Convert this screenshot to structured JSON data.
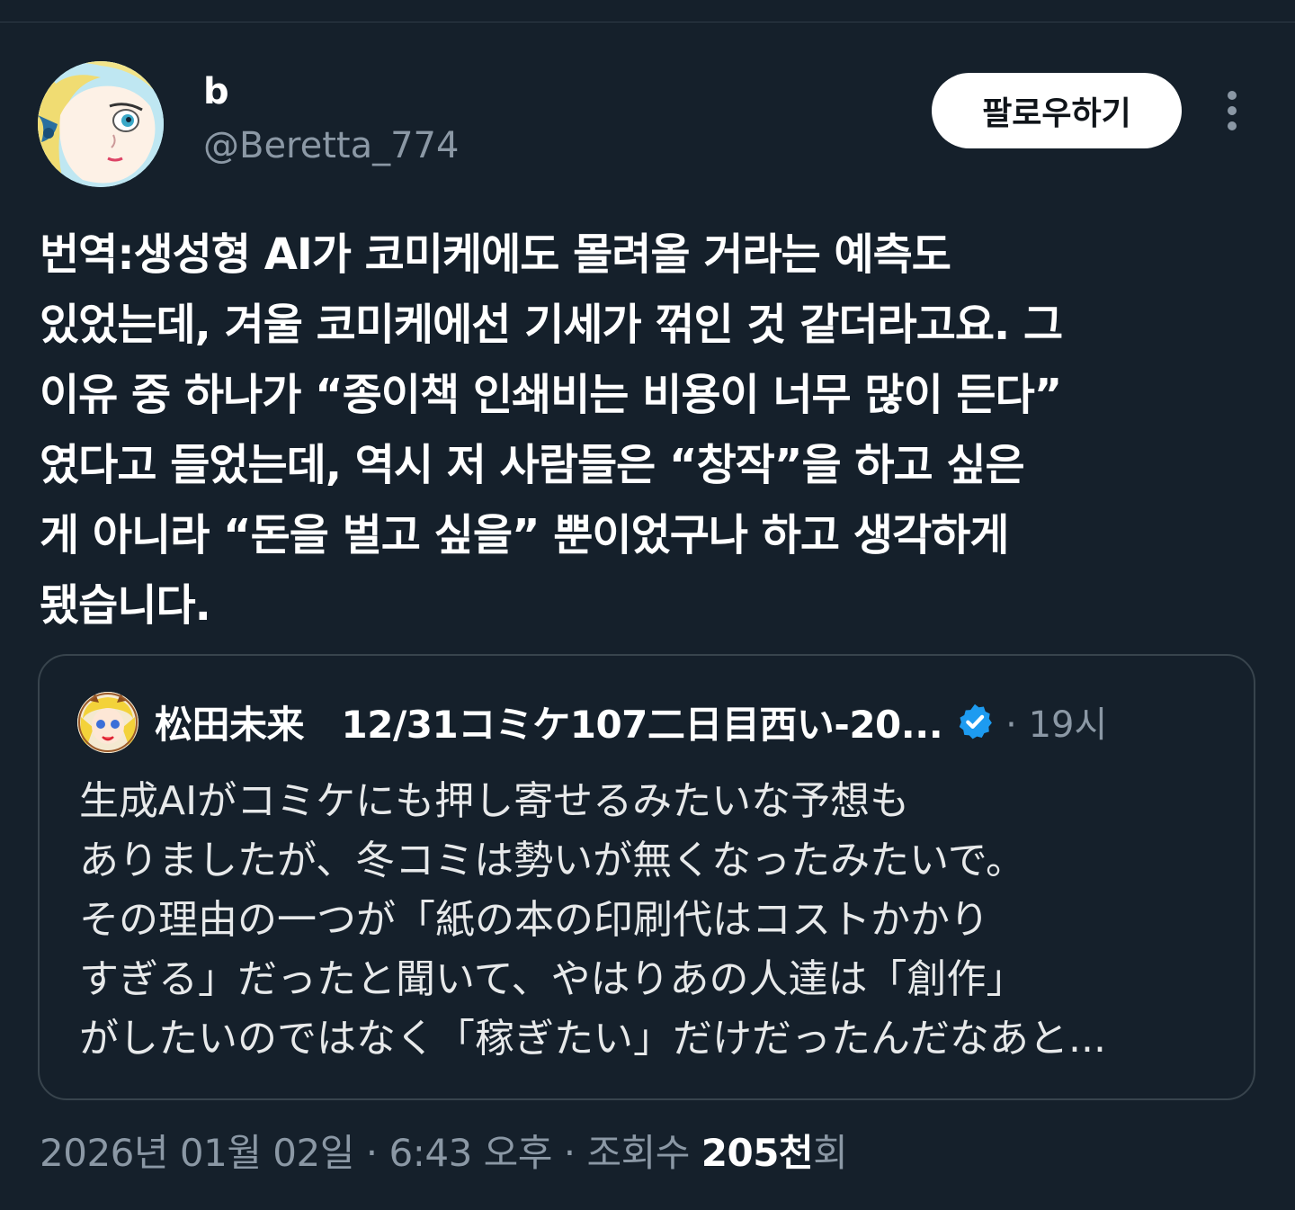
{
  "author": {
    "display_name": "b",
    "handle": "@Beretta_774",
    "follow_label": "팔로우하기"
  },
  "tweet": {
    "lines": [
      "번역:생성형 AI가 코미케에도 몰려올 거라는 예측도",
      "있었는데, 겨울 코미케에선 기세가 꺾인 것 같더라고요. 그",
      "이유 중 하나가 “종이책 인쇄비는 비용이 너무 많이 든다”",
      "였다고 들었는데, 역시 저 사람들은 “창작”을 하고 싶은",
      "게 아니라 “돈을 벌고 싶을” 뿐이었구나 하고 생각하게",
      "됐습니다."
    ]
  },
  "quote": {
    "name": "松田未来　12/31コミケ107二日目西い-20...",
    "time": "· 19시",
    "lines": [
      "生成AIがコミケにも押し寄せるみたいな予想も",
      "ありましたが、冬コミは勢いが無くなったみたいで。",
      "その理由の一つが「紙の本の印刷代はコストかかり",
      "すぎる」だったと聞いて、やはりあの人達は「創作」",
      "がしたいのではなく「稼ぎたい」だけだったんだなあと..."
    ]
  },
  "meta": {
    "date": "2026년 01월 02일",
    "sep1": " · ",
    "time": "6:43 오후",
    "sep2": " · ",
    "views_label": "조회수 ",
    "views_count": "205천",
    "views_suffix": "회"
  },
  "icons": {
    "more": "more-vertical-icon",
    "verified": "verified-badge-icon"
  },
  "colors": {
    "background": "#15202b",
    "secondary_text": "#8b98a5",
    "verified": "#1d9bf0",
    "border": "#38444d"
  }
}
